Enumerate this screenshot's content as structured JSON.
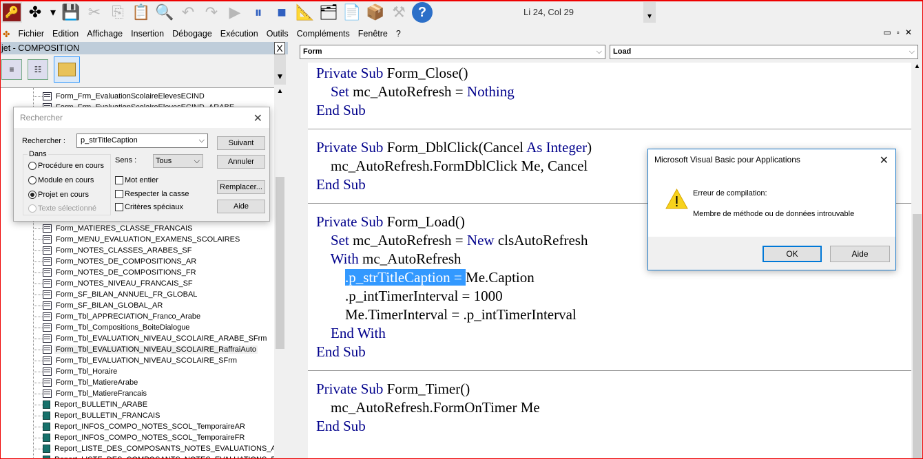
{
  "toolbar": {
    "icons": [
      "access-icon",
      "insert-object-icon",
      "dropdown-arrow-icon",
      "save-icon",
      "cut-icon",
      "copy-icon",
      "paste-icon",
      "find-icon",
      "undo-icon",
      "redo-icon",
      "run-icon",
      "pause-icon",
      "stop-icon",
      "design-mode-icon",
      "project-explorer-icon",
      "properties-icon",
      "object-browser-icon",
      "toolbox-icon",
      "help-icon"
    ],
    "position": "Li 24, Col 29"
  },
  "menu": [
    "Fichier",
    "Edition",
    "Affichage",
    "Insertion",
    "Débogage",
    "Exécution",
    "Outils",
    "Compléments",
    "Fenêtre",
    "?"
  ],
  "project": {
    "title": "jet - COMPOSITION",
    "items": [
      {
        "label": "Form_Frm_EvaluationScolaireElevesECIND",
        "type": "form"
      },
      {
        "label": "Form_Frm_EvaluationScolaireElevesECIND_ARABE",
        "type": "form"
      },
      {
        "label": "Form_MATIERES_CLASSE_FRANCAIS",
        "type": "form"
      },
      {
        "label": "Form_MENU_EVALUATION_EXAMENS_SCOLAIRES",
        "type": "form"
      },
      {
        "label": "Form_NOTES_CLASSES_ARABES_SF",
        "type": "form"
      },
      {
        "label": "Form_NOTES_DE_COMPOSITIONS_AR",
        "type": "form"
      },
      {
        "label": "Form_NOTES_DE_COMPOSITIONS_FR",
        "type": "form"
      },
      {
        "label": "Form_NOTES_NIVEAU_FRANCAIS_SF",
        "type": "form"
      },
      {
        "label": "Form_SF_BILAN_ANNUEL_FR_GLOBAL",
        "type": "form"
      },
      {
        "label": "Form_SF_BILAN_GLOBAL_AR",
        "type": "form"
      },
      {
        "label": "Form_Tbl_APPRECIATION_Franco_Arabe",
        "type": "form"
      },
      {
        "label": "Form_Tbl_Compositions_BoiteDialogue",
        "type": "form"
      },
      {
        "label": "Form_Tbl_EVALUATION_NIVEAU_SCOLAIRE_ARABE_SFrm",
        "type": "form"
      },
      {
        "label": "Form_Tbl_EVALUATION_NIVEAU_SCOLAIRE_RaffraiAuto",
        "type": "form",
        "selected": true
      },
      {
        "label": "Form_Tbl_EVALUATION_NIVEAU_SCOLAIRE_SFrm",
        "type": "form"
      },
      {
        "label": "Form_Tbl_Horaire",
        "type": "form"
      },
      {
        "label": "Form_Tbl_MatiereArabe",
        "type": "form"
      },
      {
        "label": "Form_Tbl_MatiereFrancais",
        "type": "form"
      },
      {
        "label": "Report_BULLETIN_ARABE",
        "type": "report"
      },
      {
        "label": "Report_BULLETIN_FRANCAIS",
        "type": "report"
      },
      {
        "label": "Report_INFOS_COMPO_NOTES_SCOL_TemporaireAR",
        "type": "report"
      },
      {
        "label": "Report_INFOS_COMPO_NOTES_SCOL_TemporaireFR",
        "type": "report"
      },
      {
        "label": "Report_LISTE_DES_COMPOSANTS_NOTES_EVALUATIONS_AR",
        "type": "report"
      },
      {
        "label": "Report_LISTE_DES_COMPOSANTS_NOTES_EVALUATIONS_FR",
        "type": "report"
      }
    ]
  },
  "editor": {
    "object": "Form",
    "procedure": "Load",
    "lines": [
      [
        {
          "t": "Private Sub ",
          "k": 1
        },
        {
          "t": "Form_Close()"
        }
      ],
      [
        {
          "t": "    "
        },
        {
          "t": "Set ",
          "k": 1
        },
        {
          "t": "mc_AutoRefresh = "
        },
        {
          "t": "Nothing",
          "k": 1
        }
      ],
      [
        {
          "t": "End Sub",
          "k": 1
        }
      ],
      [],
      [
        {
          "t": "Private Sub ",
          "k": 1
        },
        {
          "t": "Form_DblClick(Cancel "
        },
        {
          "t": "As Integer",
          "k": 1
        },
        {
          "t": ")"
        }
      ],
      [
        {
          "t": "    mc_AutoRefresh.FormDblClick Me, Cancel"
        }
      ],
      [
        {
          "t": "End Sub",
          "k": 1
        }
      ],
      [],
      [
        {
          "t": "Private Sub ",
          "k": 1
        },
        {
          "t": "Form_Load()"
        }
      ],
      [
        {
          "t": "    "
        },
        {
          "t": "Set ",
          "k": 1
        },
        {
          "t": "mc_AutoRefresh = "
        },
        {
          "t": "New ",
          "k": 1
        },
        {
          "t": "clsAutoRefresh"
        }
      ],
      [
        {
          "t": "    "
        },
        {
          "t": "With ",
          "k": 1
        },
        {
          "t": "mc_AutoRefresh"
        }
      ],
      [
        {
          "t": "        "
        },
        {
          "t": ".p_strTitleCaption = ",
          "s": 1
        },
        {
          "t": "Me.Caption"
        }
      ],
      [
        {
          "t": "        .p_intTimerInterval = 1000"
        }
      ],
      [
        {
          "t": "        Me.TimerInterval = .p_intTimerInterval"
        }
      ],
      [
        {
          "t": "    "
        },
        {
          "t": "End With",
          "k": 1
        }
      ],
      [
        {
          "t": "End Sub",
          "k": 1
        }
      ],
      [],
      [
        {
          "t": "Private Sub ",
          "k": 1
        },
        {
          "t": "Form_Timer()"
        }
      ],
      [
        {
          "t": "    mc_AutoRefresh.FormOnTimer Me"
        }
      ],
      [
        {
          "t": "End Sub",
          "k": 1
        }
      ]
    ]
  },
  "find": {
    "title": "Rechercher",
    "label": "Rechercher :",
    "value": "p_strTitleCaption",
    "group": "Dans",
    "options": [
      "Procédure en cours",
      "Module en cours",
      "Projet en cours",
      "Texte sélectionné"
    ],
    "selected": "Projet en cours",
    "direction_label": "Sens :",
    "direction": "Tous",
    "checks": [
      "Mot entier",
      "Respecter la casse",
      "Critères spéciaux"
    ],
    "buttons": [
      "Suivant",
      "Annuler",
      "Remplacer...",
      "Aide"
    ]
  },
  "error": {
    "title": "Microsoft Visual Basic pour Applications",
    "heading": "Erreur de compilation:",
    "message": "Membre de méthode ou de données introuvable",
    "ok": "OK",
    "help": "Aide"
  }
}
